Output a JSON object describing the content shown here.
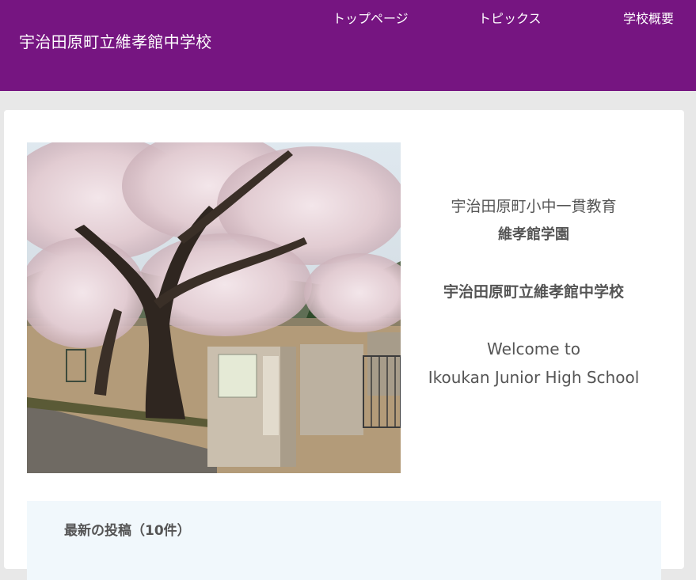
{
  "header": {
    "site_title": "宇治田原町立維孝館中学校",
    "nav": [
      "トップページ",
      "トピックス",
      "学校概要"
    ],
    "background_color": "#761581"
  },
  "hero": {
    "image": "cherry-blossom-school-gate-photo"
  },
  "intro": {
    "line1": "宇治田原町小中一貫教育",
    "line2": "維孝館学園",
    "line3": "宇治田原町立維孝館中学校",
    "line4": "Welcome to",
    "line5": "Ikoukan Junior High School"
  },
  "posts": {
    "heading": "最新の投稿（10件）",
    "background_color": "#f1f8fc"
  }
}
